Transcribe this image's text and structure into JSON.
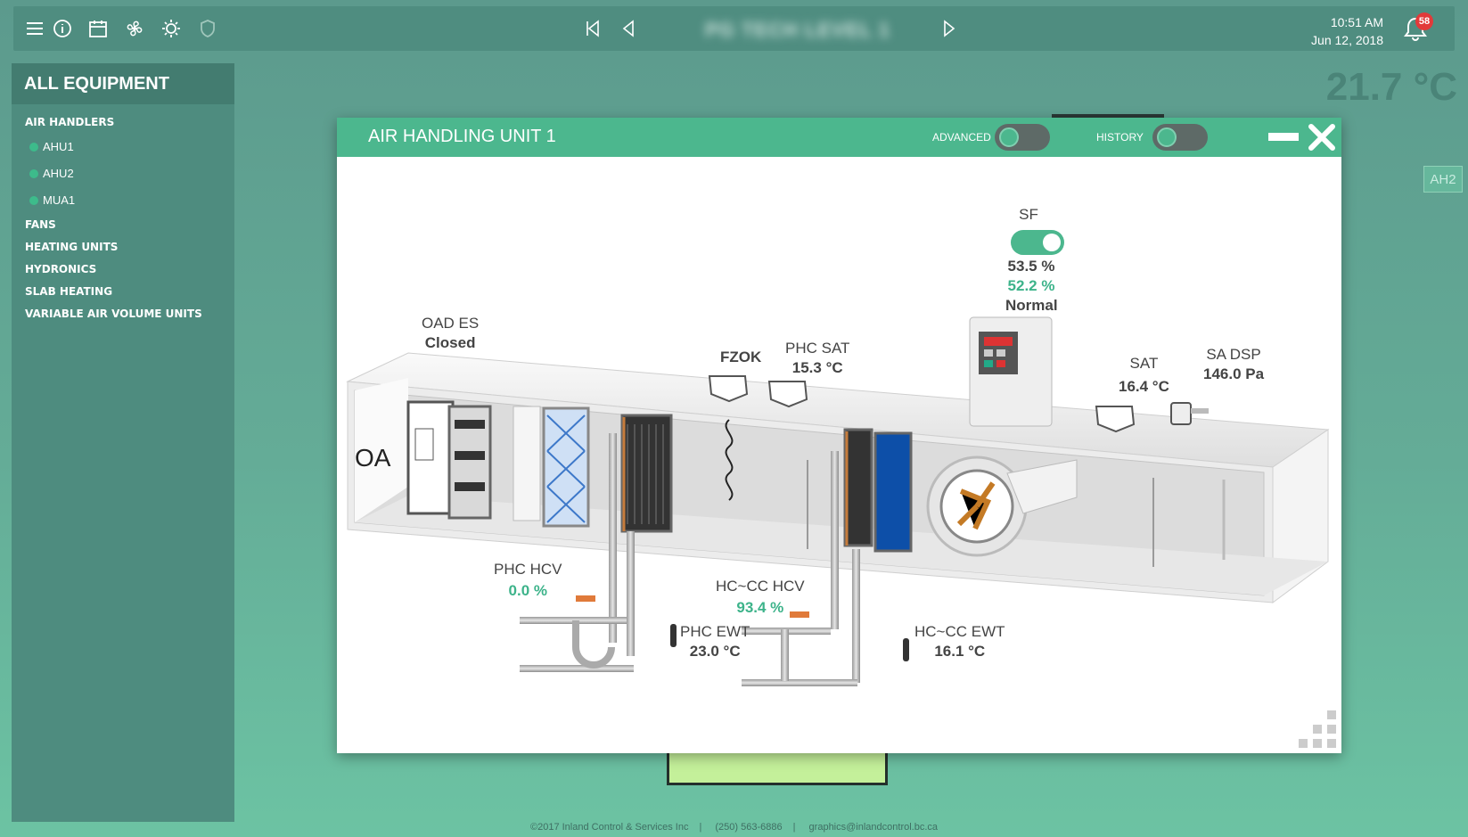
{
  "topbar": {
    "title": "PG TECH LEVEL 1",
    "time": "10:51 AM",
    "date": "Jun 12, 2018",
    "notification_count": "58"
  },
  "sidebar": {
    "header": "ALL EQUIPMENT",
    "categories": [
      {
        "label": "AIR HANDLERS",
        "items": [
          "AHU1",
          "AHU2",
          "MUA1"
        ]
      },
      {
        "label": "FANS"
      },
      {
        "label": "HEATING UNITS"
      },
      {
        "label": "HYDRONICS"
      },
      {
        "label": "SLAB HEATING"
      },
      {
        "label": "VARIABLE AIR VOLUME UNITS"
      }
    ]
  },
  "background": {
    "temperature": "21.7 °C",
    "ah2_tag": "AH2"
  },
  "modal": {
    "title": "AIR HANDLING UNIT 1",
    "advanced_label": "ADVANCED",
    "history_label": "HISTORY",
    "advanced_on": false,
    "history_on": false
  },
  "points": {
    "oa": "OA",
    "oad_es": {
      "name": "OAD ES",
      "value": "Closed"
    },
    "fzok": "FZOK",
    "phc_sat": {
      "name": "PHC SAT",
      "value": "15.3 °C"
    },
    "sf": {
      "name": "SF",
      "cmd": "53.5 %",
      "fb": "52.2 %",
      "status": "Normal",
      "on": true
    },
    "sat": {
      "name": "SAT",
      "value": "16.4 °C"
    },
    "sa_dsp": {
      "name": "SA DSP",
      "value": "146.0 Pa"
    },
    "phc_hcv": {
      "name": "PHC HCV",
      "value": "0.0 %"
    },
    "hccc_hcv": {
      "name": "HC~CC HCV",
      "value": "93.4 %"
    },
    "phc_ewt": {
      "name": "PHC EWT",
      "value": "23.0 °C"
    },
    "hccc_ewt": {
      "name": "HC~CC EWT",
      "value": "16.1 °C"
    }
  },
  "footer": {
    "copyright": "©2017 Inland Control & Services Inc",
    "phone": "(250) 563-6886",
    "email": "graphics@inlandcontrol.bc.ca"
  },
  "colors": {
    "accent": "#4cb78e",
    "value_green": "#3db38a",
    "topbar": "#4f8d80",
    "sidebar": "#4e8c7f"
  },
  "icons": [
    "menu-icon",
    "info-icon",
    "calendar-icon",
    "fan-icon",
    "sun-icon",
    "shield-icon",
    "first-page-icon",
    "prev-icon",
    "next-icon",
    "bell-icon",
    "close-icon",
    "resize-grip-icon"
  ]
}
